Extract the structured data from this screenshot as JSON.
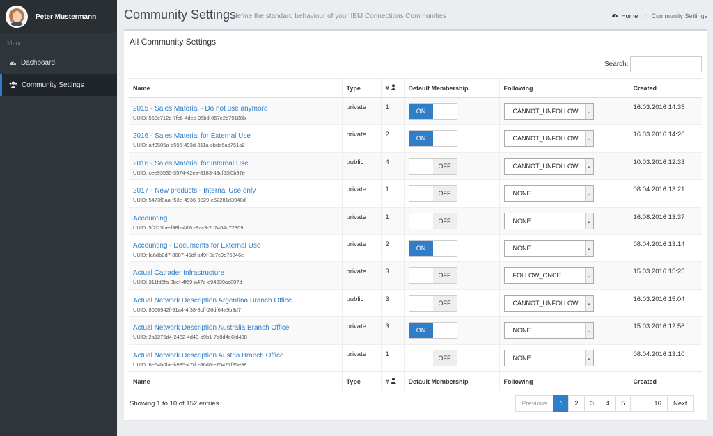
{
  "sidebar": {
    "user_name": "Peter Mustermann",
    "menu_label": "Menu",
    "items": [
      {
        "label": "Dashboard",
        "icon": "dashboard-icon"
      },
      {
        "label": "Community Settings",
        "icon": "users-icon"
      }
    ]
  },
  "header": {
    "title": "Community Settings",
    "subtitle": "define the standard behaviour of your IBM Connections Communities",
    "breadcrumb": {
      "home": "Home",
      "current": "Community Settings"
    }
  },
  "panel": {
    "title": "All Community Settings",
    "search_label": "Search:",
    "search_value": ""
  },
  "table": {
    "headers": {
      "name": "Name",
      "type": "Type",
      "count": "#",
      "membership": "Default Membership",
      "following": "Following",
      "created": "Created"
    },
    "rows": [
      {
        "name": "2015 - Sales Material - Do not use anymore",
        "uuid": "UUID: 563c712c-7fc6-4dec-95bd-067e2b79188b",
        "type": "private",
        "count": "1",
        "membership": "ON",
        "following": "CANNOT_UNFOLLOW",
        "created": "16.03.2016 14:35"
      },
      {
        "name": "2016 - Sales Material for External Use",
        "uuid": "UUID: aff9505a-b595-493d-811a-cbdd6ad751a2",
        "type": "private",
        "count": "2",
        "membership": "ON",
        "following": "CANNOT_UNFOLLOW",
        "created": "16.03.2016 14:26"
      },
      {
        "name": "2016 - Sales Material for Internal Use",
        "uuid": "UUID: cee93535-3574-42ea-8183-49cf53f0b97e",
        "type": "public",
        "count": "4",
        "membership": "OFF",
        "following": "CANNOT_UNFOLLOW",
        "created": "10.03.2016 12:33"
      },
      {
        "name": "2017 - New products - Internal Use only",
        "uuid": "UUID: 5473f0aa-f53e-4936-9829-e52281d3940d",
        "type": "private",
        "count": "1",
        "membership": "OFF",
        "following": "NONE",
        "created": "08.04.2016 13:21"
      },
      {
        "name": "Accounting",
        "uuid": "UUID: 5f2f15be-f98b-487c-9ac3-2c7464d72309",
        "type": "private",
        "count": "1",
        "membership": "OFF",
        "following": "NONE",
        "created": "16.08.2016 13:37"
      },
      {
        "name": "Accounting - Documents for External Use",
        "uuid": "UUID: fa6db0d7-8007-49df-a49f-0e7c9d76846e",
        "type": "private",
        "count": "2",
        "membership": "ON",
        "following": "NONE",
        "created": "08.04.2016 13:14"
      },
      {
        "name": "Actual Catrader Infrastructure",
        "uuid": "UUID: 311fd6fa-8bef-4f69-a47e-e94839ac807d",
        "type": "private",
        "count": "3",
        "membership": "OFF",
        "following": "FOLLOW_ONCE",
        "created": "15.03.2016 15:25"
      },
      {
        "name": "Actual Network Description Argentina Branch Office",
        "uuid": "UUID: 8066942f-91a4-4f38-8cff-26df64a9b9d7",
        "type": "public",
        "count": "3",
        "membership": "OFF",
        "following": "CANNOT_UNFOLLOW",
        "created": "16.03.2016 15:04"
      },
      {
        "name": "Actual Network Description Australia Branch Office",
        "uuid": "UUID: 2a1275d4-2482-4d40-a9b1-7e8d4e6fd488",
        "type": "private",
        "count": "3",
        "membership": "ON",
        "following": "NONE",
        "created": "15.03.2016 12:56"
      },
      {
        "name": "Actual Network Description Austria Branch Office",
        "uuid": "UUID: 6e64b0be-b985-47dc-86d6-e75427f85e98",
        "type": "private",
        "count": "1",
        "membership": "OFF",
        "following": "NONE",
        "created": "08.04.2016 13:10"
      }
    ]
  },
  "footer": {
    "showing": "Showing 1 to 10 of 152 entries",
    "pagination": [
      "Previous",
      "1",
      "2",
      "3",
      "4",
      "5",
      "...",
      "16",
      "Next"
    ],
    "active_page": "1"
  },
  "colors": {
    "accent": "#2f7ec7",
    "sidebar": "#2f353a"
  }
}
